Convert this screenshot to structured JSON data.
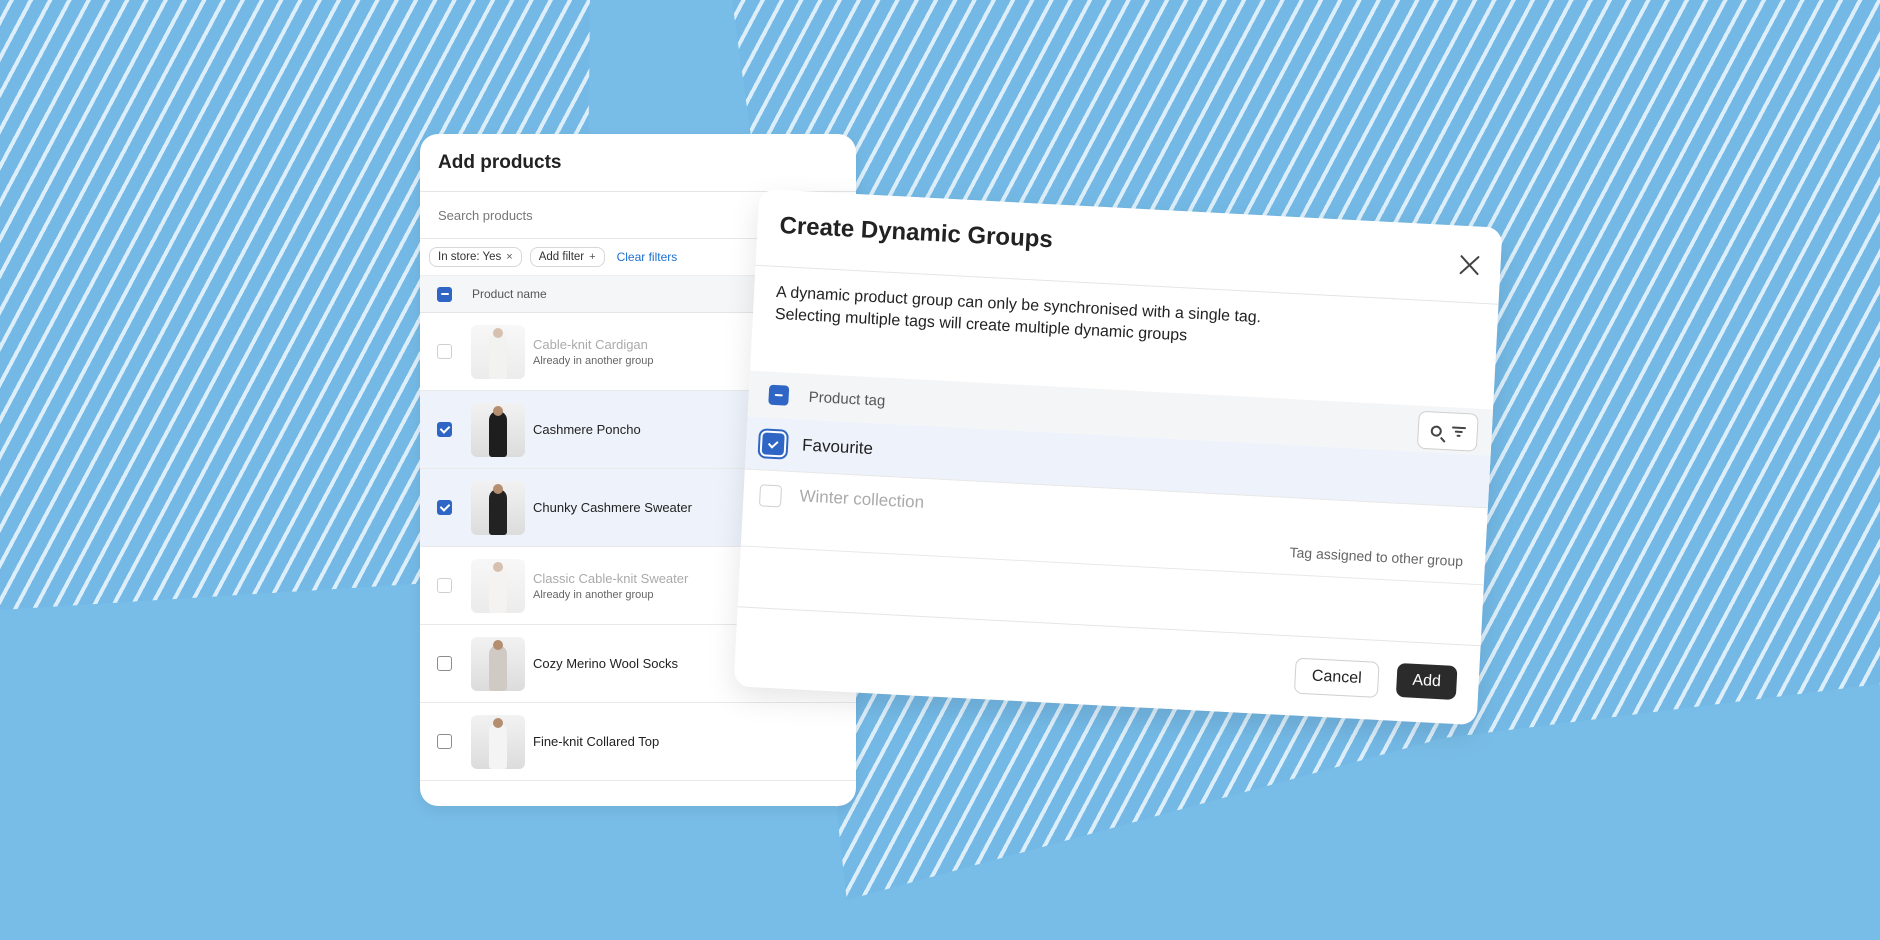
{
  "panel": {
    "title": "Add products",
    "search_placeholder": "Search products",
    "chips": [
      {
        "label": "In store: Yes",
        "suffix": "×"
      },
      {
        "label": "Add filter",
        "suffix": "+"
      }
    ],
    "clear_filters": "Clear filters",
    "column_header": "Product name",
    "products": [
      {
        "name": "Cable-knit Cardigan",
        "sub": "Already in another group",
        "checked": false,
        "disabled": true
      },
      {
        "name": "Cashmere Poncho",
        "sub": "",
        "checked": true,
        "disabled": false
      },
      {
        "name": "Chunky Cashmere Sweater",
        "sub": "",
        "checked": true,
        "disabled": false
      },
      {
        "name": "Classic Cable-knit Sweater",
        "sub": "Already in another group",
        "checked": false,
        "disabled": true
      },
      {
        "name": "Cozy Merino Wool Socks",
        "sub": "",
        "checked": false,
        "disabled": false
      },
      {
        "name": "Fine-knit Collared Top",
        "sub": "",
        "checked": false,
        "disabled": false
      }
    ]
  },
  "dialog": {
    "title": "Create Dynamic Groups",
    "description_line1": "A dynamic product group can only be synchronised with a single tag.",
    "description_line2": "Selecting multiple tags will create multiple dynamic groups",
    "column_header": "Product tag",
    "tags": [
      {
        "label": "Favourite",
        "checked": true,
        "disabled": false
      },
      {
        "label": "Winter collection",
        "checked": false,
        "disabled": true,
        "note": "Tag assigned to other group"
      }
    ],
    "cancel_label": "Cancel",
    "add_label": "Add"
  },
  "colors": {
    "background": "#78bde8",
    "accent": "#2f66c6",
    "primary_button": "#2b2b2b"
  },
  "icons": [
    "search-icon",
    "filter-icon",
    "close-icon",
    "checkbox-icon"
  ]
}
